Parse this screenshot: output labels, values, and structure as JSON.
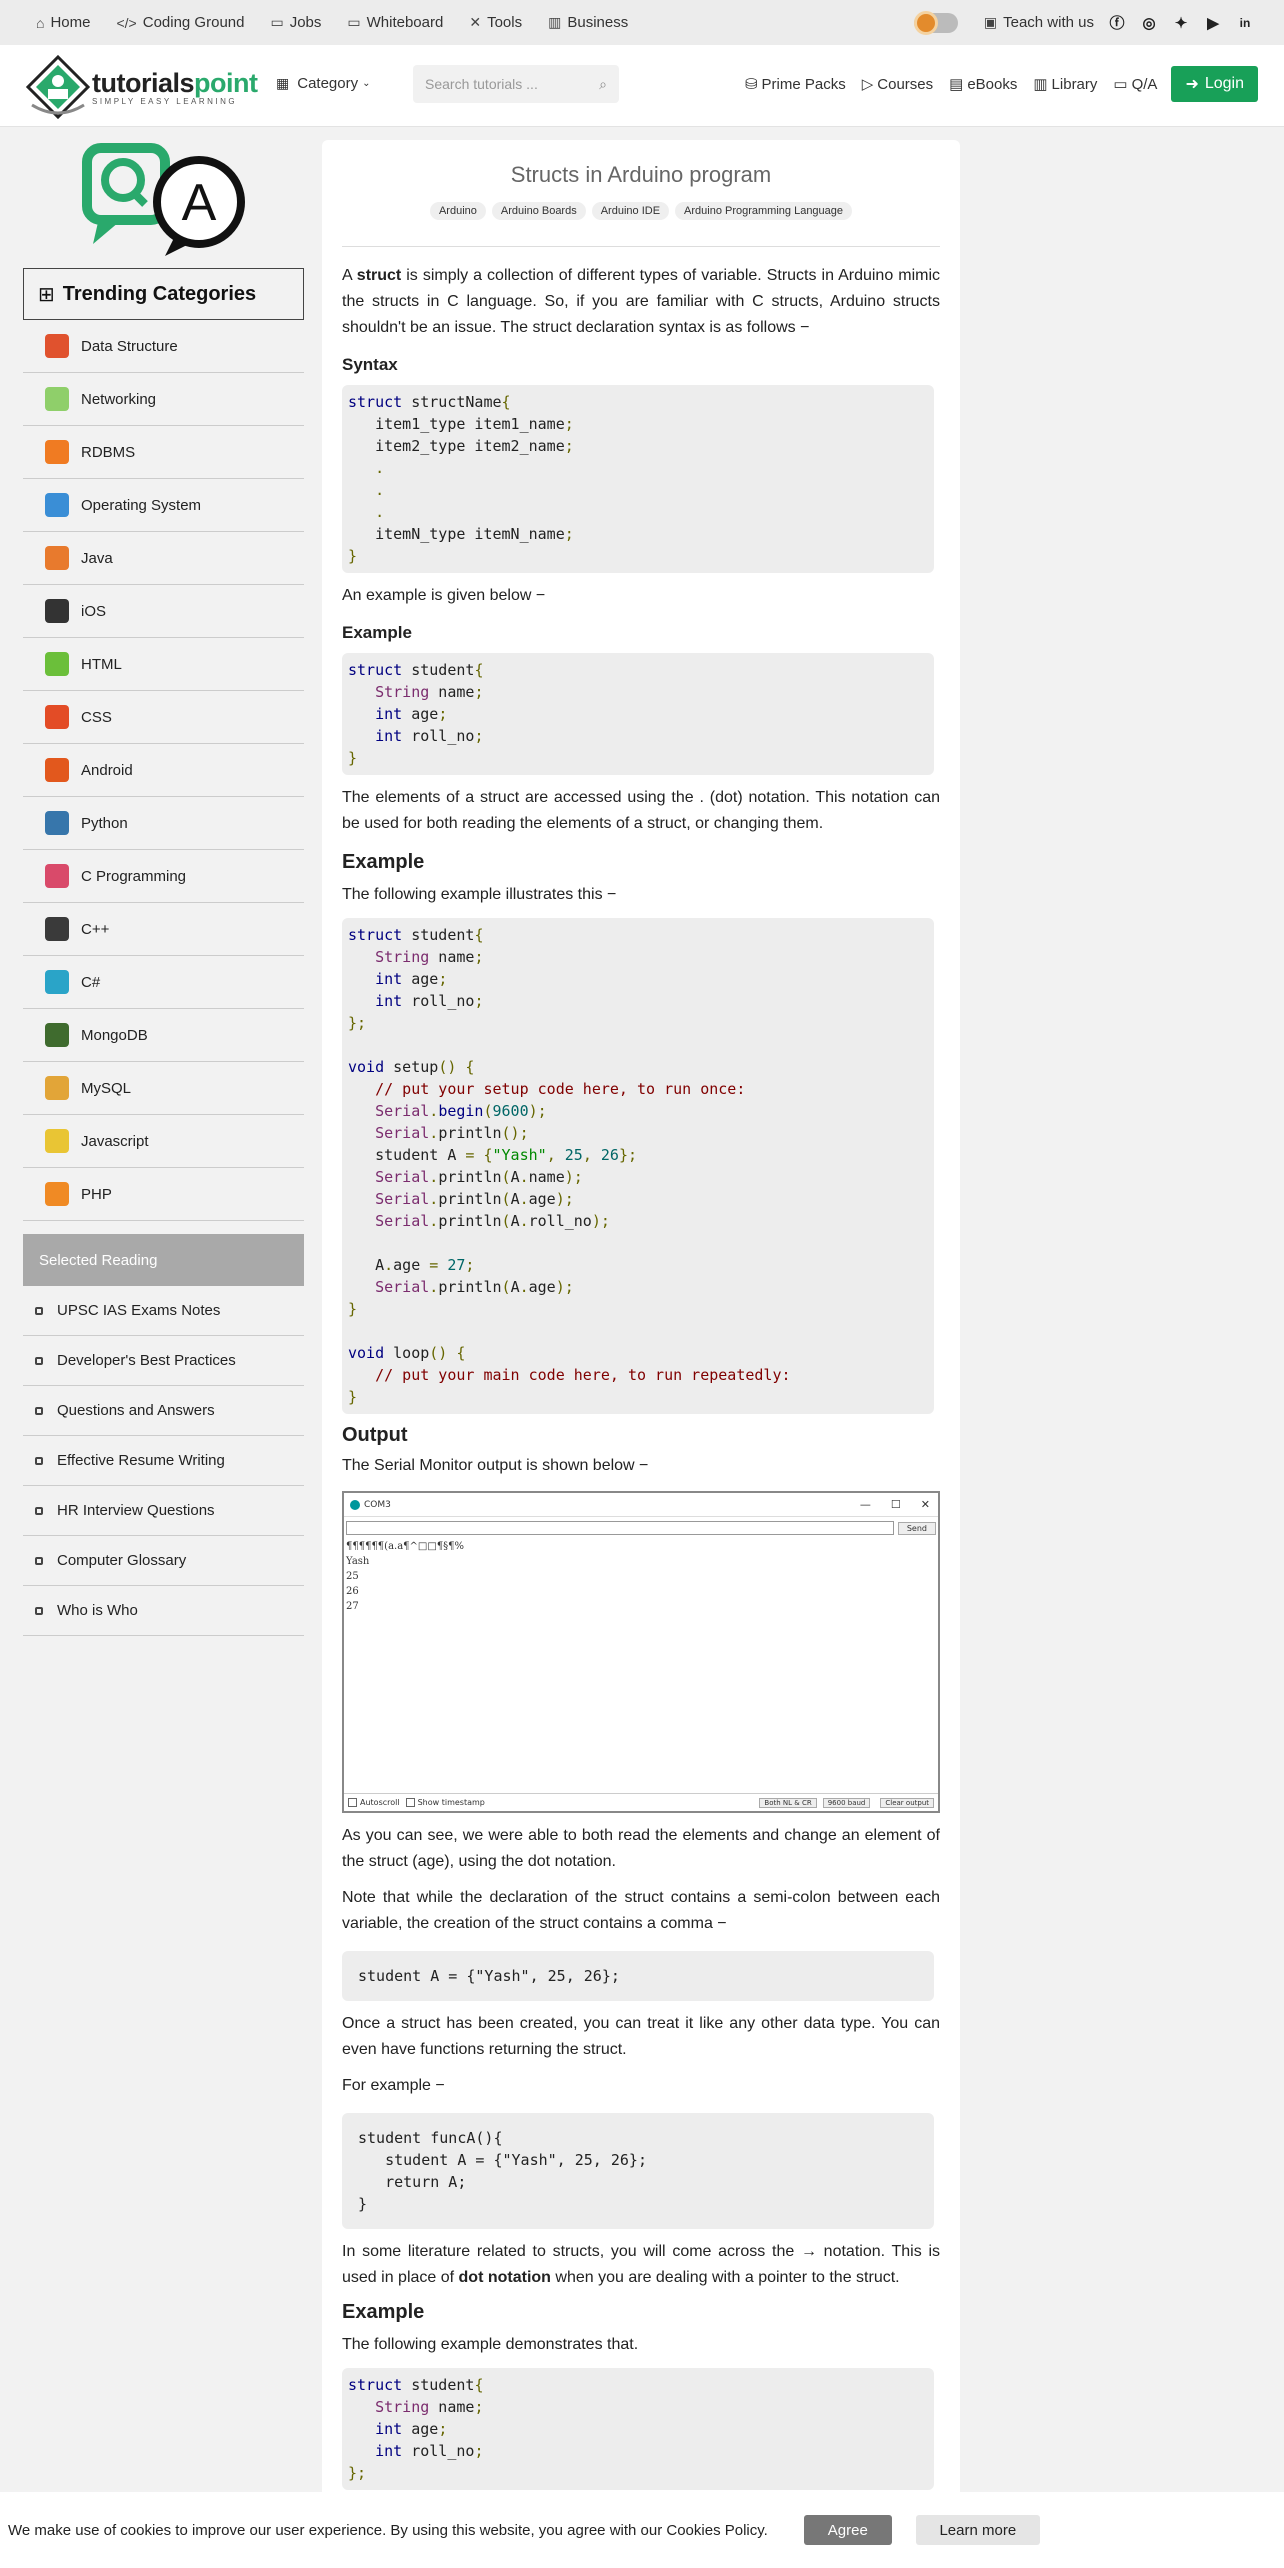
{
  "topbar": {
    "items": [
      "Home",
      "Coding Ground",
      "Jobs",
      "Whiteboard",
      "Tools",
      "Business"
    ],
    "teach": "Teach with us",
    "social": [
      "f",
      "ig",
      "tw",
      "yt",
      "in"
    ]
  },
  "header": {
    "logo_main": "tutorials",
    "logo_accent": "point",
    "logo_tagline": "SIMPLY EASY LEARNING",
    "category": "Category",
    "search_placeholder": "Search tutorials ...",
    "nav": [
      "Prime Packs",
      "Courses",
      "eBooks",
      "Library",
      "Q/A"
    ],
    "login": "Login"
  },
  "sidebar": {
    "trending_title": "Trending Categories",
    "categories": [
      {
        "label": "Data Structure",
        "color": "#e0522e"
      },
      {
        "label": "Networking",
        "color": "#8fcf6a"
      },
      {
        "label": "RDBMS",
        "color": "#f07b22"
      },
      {
        "label": "Operating System",
        "color": "#3a8ed6"
      },
      {
        "label": "Java",
        "color": "#e87a2d"
      },
      {
        "label": "iOS",
        "color": "#333333"
      },
      {
        "label": "HTML",
        "color": "#6bbf3a"
      },
      {
        "label": "CSS",
        "color": "#e34c26"
      },
      {
        "label": "Android",
        "color": "#e2581d"
      },
      {
        "label": "Python",
        "color": "#3776ab"
      },
      {
        "label": "C Programming",
        "color": "#d94a6a"
      },
      {
        "label": "C++",
        "color": "#3a3a3a"
      },
      {
        "label": "C#",
        "color": "#2aa4c8"
      },
      {
        "label": "MongoDB",
        "color": "#3f6b2e"
      },
      {
        "label": "MySQL",
        "color": "#e2a538"
      },
      {
        "label": "Javascript",
        "color": "#e9c534"
      },
      {
        "label": "PHP",
        "color": "#f08a24"
      }
    ],
    "selected_title": "Selected Reading",
    "reading": [
      "UPSC IAS Exams Notes",
      "Developer's Best Practices",
      "Questions and Answers",
      "Effective Resume Writing",
      "HR Interview Questions",
      "Computer Glossary",
      "Who is Who"
    ]
  },
  "article": {
    "title": "Structs in Arduino program",
    "tags": [
      "Arduino",
      "Arduino Boards",
      "Arduino IDE",
      "Arduino Programming Language"
    ],
    "p1_pre": "A ",
    "p1_bold": "struct",
    "p1_post": " is simply a collection of different types of variable. Structs in Arduino mimic the structs in C language. So, if you are familiar with C structs, Arduino structs shouldn't be an issue. The struct declaration syntax is as follows −",
    "h_syntax": "Syntax",
    "p2": "An example is given below −",
    "h_example1": "Example",
    "p3": "The elements of a struct are accessed using the . (dot) notation. This notation can be used for both reading the elements of a struct, or changing them.",
    "h_example2": "Example",
    "p4": "The following example illustrates this −",
    "h_output": "Output",
    "p5": "The Serial Monitor output is shown below −",
    "p6": "As you can see, we were able to both read the elements and change an element of the struct (age), using the dot notation.",
    "p7": "Note that while the declaration of the struct contains a semi-colon between each variable, the creation of the struct contains a comma −",
    "code_init": "student A = {\"Yash\", 25, 26};",
    "p8": "Once a struct has been created, you can treat it like any other data type. You can even have functions returning the struct.",
    "p9": "For example −",
    "code_func": "student funcA(){\n   student A = {\"Yash\", 25, 26};\n   return A;\n}",
    "p10_pre": "In some literature related to structs, you will come across the → notation. This is used in place of ",
    "p10_bold": "dot notation",
    "p10_post": " when you are dealing with a pointer to the struct.",
    "h_example3": "Example",
    "p11": "The following example demonstrates that."
  },
  "serial_monitor": {
    "title": "COM3",
    "send": "Send",
    "output": [
      "¶¶¶¶¶¶(a.a¶^□□¶§¶%",
      "Yash",
      "25",
      "26",
      "27"
    ],
    "autoscroll": "Autoscroll",
    "timestamp": "Show timestamp",
    "line_ending": "Both NL & CR",
    "baud": "9600 baud",
    "clear": "Clear output"
  },
  "cookie": {
    "text": "We make use of cookies to improve our user experience. By using this website, you agree with our Cookies Policy.",
    "agree": "Agree",
    "learn": "Learn more"
  }
}
